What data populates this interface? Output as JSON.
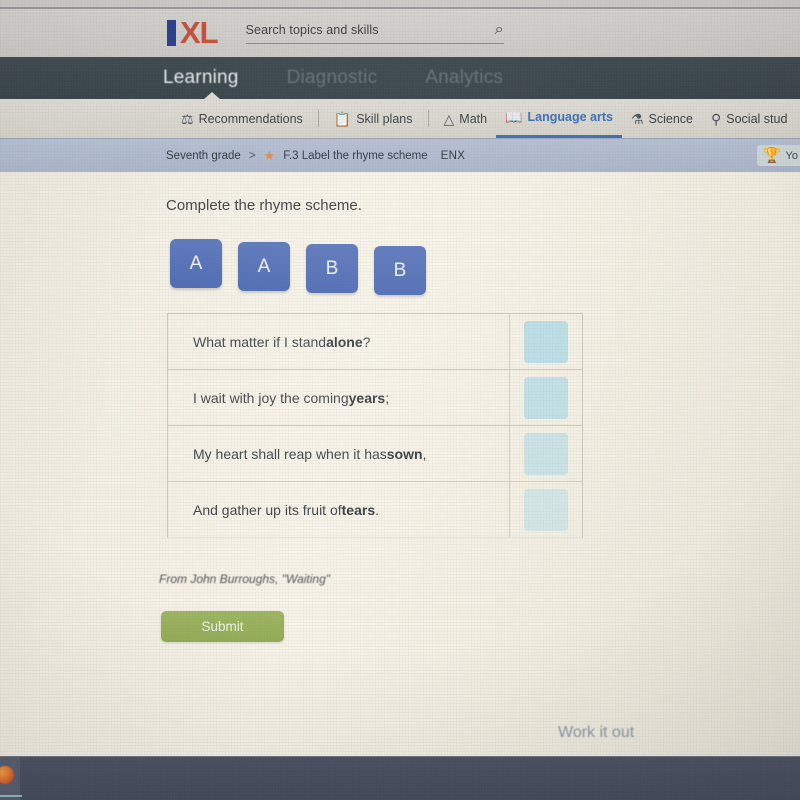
{
  "header": {
    "logo_bar": "",
    "logo_text": "XL",
    "search": {
      "value": "Search topics and skills",
      "icon": "search-icon",
      "glyph": "⌕"
    }
  },
  "primary_nav": {
    "items": [
      {
        "label": "Learning",
        "active": true
      },
      {
        "label": "Diagnostic",
        "active": false
      },
      {
        "label": "Analytics",
        "active": false
      }
    ]
  },
  "subject_nav": {
    "items": [
      {
        "label": "Recommendations",
        "icon": "recommendations-icon",
        "glyph": "⚗",
        "active": false
      },
      {
        "label": "Skill plans",
        "icon": "skill-plans-icon",
        "glyph": "📋",
        "active": false
      },
      {
        "label": "Math",
        "icon": "math-icon",
        "glyph": "◭",
        "active": false
      },
      {
        "label": "Language arts",
        "icon": "language-arts-icon",
        "glyph": "📖",
        "active": true
      },
      {
        "label": "Science",
        "icon": "science-icon",
        "glyph": "⚗",
        "active": false
      },
      {
        "label": "Social stud",
        "icon": "social-studies-icon",
        "glyph": "⚲",
        "active": false
      }
    ]
  },
  "breadcrumb": {
    "grade": "Seventh grade",
    "separator": ">",
    "star": "★",
    "skill": "F.3 Label the rhyme scheme",
    "code": "ENX",
    "award": {
      "trophy": "🏆",
      "text": "Yo"
    }
  },
  "question": {
    "prompt": "Complete the rhyme scheme.",
    "tiles": [
      {
        "label": "A"
      },
      {
        "label": "A"
      },
      {
        "label": "B"
      },
      {
        "label": "B"
      }
    ],
    "lines": [
      {
        "before": "What matter if I stand ",
        "rhyme": "alone",
        "after": "?",
        "answer": ""
      },
      {
        "before": "I wait with joy the coming ",
        "rhyme": "years",
        "after": ";",
        "answer": ""
      },
      {
        "before": "My heart shall reap when it has ",
        "rhyme": "sown",
        "after": ",",
        "answer": ""
      },
      {
        "before": "And gather up its fruit of ",
        "rhyme": "tears",
        "after": ".",
        "answer": ""
      }
    ],
    "attribution": "From John Burroughs, \"Waiting\"",
    "submit_label": "Submit",
    "work_it_out_label": "Work it out"
  },
  "colors": {
    "tile_blue": "#4765b2",
    "dropzone_cyan": "#b9dde6",
    "submit_green": "#93ac57",
    "active_link_blue": "#3a6fb8",
    "star_orange": "#e8883a",
    "logo_red": "#c8503c",
    "logo_blue": "#2c3f91"
  }
}
